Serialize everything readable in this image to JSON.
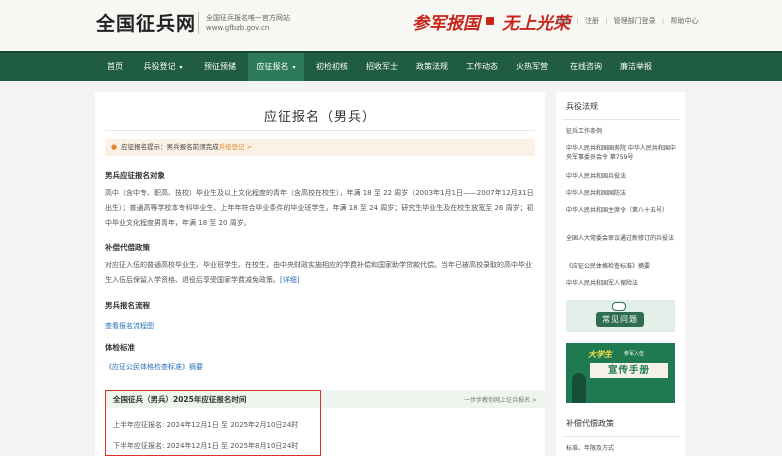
{
  "header": {
    "site_title": "全国征兵网",
    "subtitle_line1": "全国征兵报名唯一官方网站",
    "subtitle_line2": "www.gfbzb.gov.cn",
    "slogan_left": "参军报国",
    "slogan_right": "无上光荣",
    "top_links": [
      "登录",
      "注册",
      "管理部门登录",
      "帮助中心"
    ]
  },
  "nav": {
    "items": [
      {
        "label": "首页"
      },
      {
        "label": "兵役登记",
        "has_dropdown": true
      },
      {
        "label": "预征预储"
      },
      {
        "label": "应征报名",
        "has_dropdown": true,
        "active": true
      },
      {
        "label": "初检初核"
      },
      {
        "label": "招收军士"
      },
      {
        "label": "政策法规"
      },
      {
        "label": "工作动态"
      },
      {
        "label": "火热军营"
      },
      {
        "label": "在线咨询"
      },
      {
        "label": "廉洁举报"
      }
    ]
  },
  "main": {
    "title": "应征报名（男兵）",
    "notice_prefix": "应征报名提示：男兵报名前须完成",
    "notice_link": "兵役登记 >",
    "sections": {
      "target_heading": "男兵应征报名对象",
      "target_text": "高中（含中专、职高、技校）毕业生及以上文化程度的青年（含高校在校生），年满 18 至 22 周岁（2003年1月1日——2007年12月31日出生）；普通高等学校本专科毕业生、上年年符合毕业条件的毕业班学生，年满 18 至 24 周岁；研究生毕业生及在校生放宽至 26 周岁；初中毕业文化程度男青年，年满 18 至 20 周岁。",
      "comp_heading": "补偿代偿政策",
      "comp_text": "对应征入伍的普通高校毕业生、毕业班学生、在校生，由中央财政实施相应的学费补偿和国家助学贷款代偿。当年已被高校录取的高中毕业生入伍后保留入学资格、退役后享受国家学费减免政策。",
      "comp_more": "[详细]",
      "process_heading": "男兵报名流程",
      "process_link": "查看报名流程图",
      "physical_heading": "体检标准",
      "physical_link": "《应征公民体格检查标准》摘要"
    },
    "time_box": {
      "title": "全国征兵（男兵）2025年应征报名时间",
      "link": "一步步教你网上征兵报名 >",
      "first_half_label": "上半年应征报名:",
      "first_half_value": "2024年12月1日 至 2025年2月10日24时",
      "second_half_label": "下半年应征报名:",
      "second_half_value": "2024年12月1日 至 2025年8月10日24时"
    }
  },
  "sidebar": {
    "laws_heading": "兵役法规",
    "laws": [
      "征兵工作条例",
      "中华人民共和国国务院 中华人民共和国中央军事委员会令 第759号",
      "中华人民共和国兵役法",
      "中华人民共和国国防法",
      "中华人民共和国主席令（第八十五号）",
      "全国人大常委会审议通过新修订的兵役法",
      "《应征公民体格检查标准》摘要",
      "中华人民共和国军人保险法"
    ],
    "banner1_text": "常见问题",
    "banner2_line1": "大学生",
    "banner2_line2": "参军入伍",
    "banner2_line3": "宣传手册",
    "comp_heading": "补偿代偿政策",
    "comp_first": "标准、年限及方式"
  }
}
